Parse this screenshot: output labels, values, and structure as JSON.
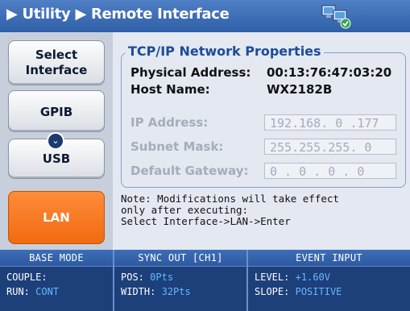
{
  "header": {
    "breadcrumb": "▶ Utility ▶ Remote Interface",
    "icon": "network-icon"
  },
  "sidebar": {
    "select_label_1": "Select",
    "select_label_2": "Interface",
    "gpib_label": "GPIB",
    "chevron_glyph": "⌄",
    "usb_label": "USB",
    "lan_label": "LAN"
  },
  "tcpip": {
    "title": "TCP/IP Network Properties",
    "physical_address_label": "Physical Address:",
    "physical_address_value": "00:13:76:47:03:20",
    "host_name_label": "Host Name:",
    "host_name_value": "WX2182B",
    "ip_label": "IP Address:",
    "ip_value": "192.168. 0 .177",
    "mask_label": "Subnet Mask:",
    "mask_value": "255.255.255. 0",
    "gateway_label": "Default Gateway:",
    "gateway_value": " 0 . 0 . 0 . 0"
  },
  "note": "Note: Modifications will take effect\nonly after executing:\nSelect Interface->LAN->Enter",
  "footer": {
    "base_mode": {
      "title": "BASE MODE",
      "couple_label": "COUPLE:",
      "couple_value": "",
      "run_label": "RUN:",
      "run_value": "CONT"
    },
    "sync_out": {
      "title": "SYNC OUT [CH1]",
      "pos_label": "POS:",
      "pos_value": "0Pts",
      "width_label": "WIDTH:",
      "width_value": "32Pts"
    },
    "event_input": {
      "title": "EVENT INPUT",
      "level_label": "LEVEL:",
      "level_value": "+1.60V",
      "slope_label": "SLOPE:",
      "slope_value": "POSITIVE"
    }
  },
  "colors": {
    "accent": "#f16a10",
    "header_blue": "#2f5fa6",
    "title_blue": "#1b4c96",
    "value_blue": "#66b8ff"
  }
}
